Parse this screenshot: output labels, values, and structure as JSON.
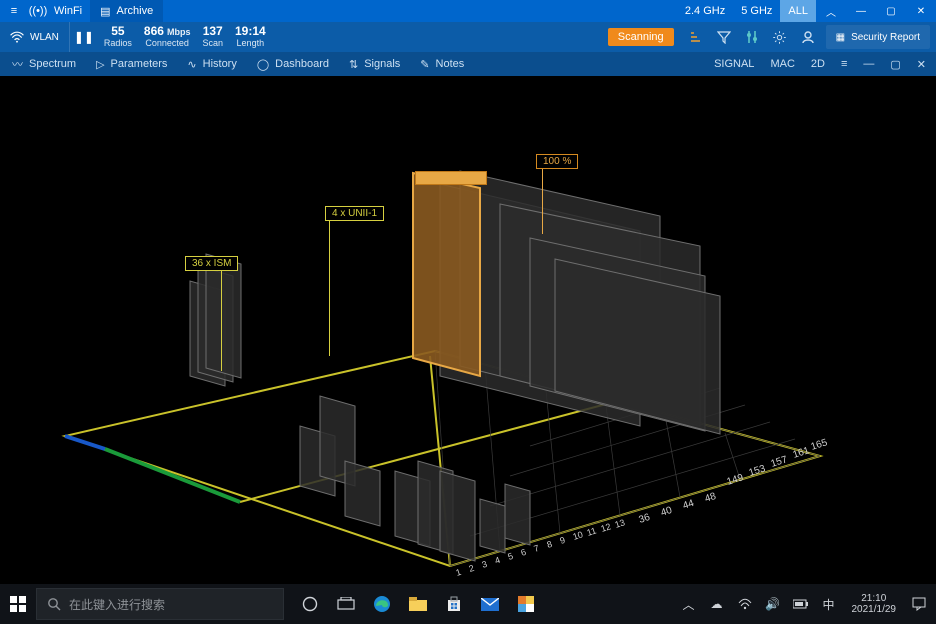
{
  "titlebar": {
    "app_name": "WinFi",
    "archive_tab": "Archive",
    "bands": {
      "b24": "2.4 GHz",
      "b5": "5 GHz",
      "all": "ALL"
    }
  },
  "toolbar": {
    "wlan_label": "WLAN",
    "stats": {
      "radios": {
        "value": "55",
        "label": "Radios"
      },
      "connected": {
        "value": "866",
        "unit": "Mbps",
        "label": "Connected"
      },
      "scan": {
        "value": "137",
        "label": "Scan"
      },
      "length": {
        "value": "19:14",
        "label": "Length"
      }
    },
    "scanning_label": "Scanning",
    "security_report": "Security Report"
  },
  "subbar": {
    "spectrum": "Spectrum",
    "parameters": "Parameters",
    "history": "History",
    "dashboard": "Dashboard",
    "signals": "Signals",
    "notes": "Notes",
    "right": {
      "signal": "SIGNAL",
      "mac": "MAC",
      "view": "2D"
    }
  },
  "chart_data": {
    "type": "3d-spectrum",
    "callouts": {
      "ism": "36 x ISM",
      "unii": "4 x UNII-1",
      "highlight_pct": "100 %"
    },
    "x_channels_24": [
      "1",
      "2",
      "3",
      "4",
      "5",
      "6",
      "7",
      "8",
      "9",
      "10",
      "11",
      "12",
      "13"
    ],
    "x_channels_5": [
      "36",
      "40",
      "44",
      "48",
      "149",
      "153",
      "157",
      "161",
      "165"
    ],
    "note": "3D signal-strength shafts on channel grid; heights approximate, not labeled numerically in image"
  },
  "taskbar": {
    "search_placeholder": "在此键入进行搜索",
    "clock_time": "21:10",
    "clock_date": "2021/1/29"
  }
}
